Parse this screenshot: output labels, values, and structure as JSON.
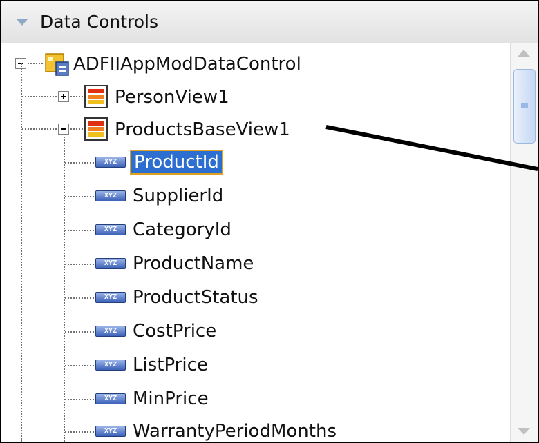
{
  "panel": {
    "title": "Data Controls"
  },
  "tree": {
    "root": {
      "label": "ADFIIAppModDataControl",
      "expanded": true,
      "icon": "data-control-icon"
    },
    "views": [
      {
        "label": "PersonView1",
        "expanded": false,
        "icon": "view-object-icon"
      },
      {
        "label": "ProductsBaseView1",
        "expanded": true,
        "icon": "view-object-icon"
      }
    ],
    "attributes": [
      {
        "label": "ProductId",
        "selected": true
      },
      {
        "label": "SupplierId"
      },
      {
        "label": "CategoryId"
      },
      {
        "label": "ProductName"
      },
      {
        "label": "ProductStatus"
      },
      {
        "label": "CostPrice"
      },
      {
        "label": "ListPrice"
      },
      {
        "label": "MinPrice"
      },
      {
        "label": "WarrantyPeriodMonths"
      }
    ],
    "attribute_icon_text": "XYZ"
  },
  "colors": {
    "selection": "#2d6fd0",
    "selection_border": "#e0a020",
    "view_icon": [
      "#e03010",
      "#f08020",
      "#f0c020"
    ]
  }
}
